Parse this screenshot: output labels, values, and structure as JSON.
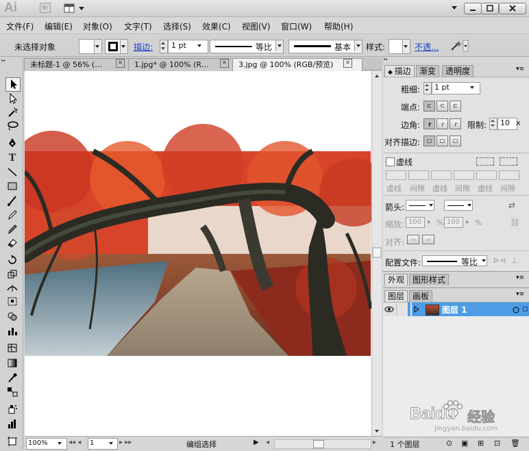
{
  "app": {
    "logo": "Ai",
    "bridge": "Br"
  },
  "menubar": [
    "文件(F)",
    "编辑(E)",
    "对象(O)",
    "文字(T)",
    "选择(S)",
    "效果(C)",
    "视图(V)",
    "窗口(W)",
    "帮助(H)"
  ],
  "control": {
    "selection_status": "未选择对象",
    "stroke_label": "描边:",
    "stroke_weight": "1 pt",
    "profile_label": "等比",
    "brush_label": "基本",
    "style_label": "样式:",
    "opacity_link": "不透..."
  },
  "tabs": [
    {
      "label": "未标题-1 @ 56% (…",
      "active": false
    },
    {
      "label": "1.jpg* @ 100% (R…",
      "active": false
    },
    {
      "label": "3.jpg @ 100% (RGB/预览)",
      "active": true
    }
  ],
  "status": {
    "zoom": "100%",
    "artboard": "1",
    "mode": "编组选择"
  },
  "stroke_panel": {
    "tabs": [
      "描边",
      "渐变",
      "透明度"
    ],
    "weight_label": "粗细:",
    "weight_value": "1 pt",
    "cap_label": "端点:",
    "corner_label": "边角:",
    "limit_label": "限制:",
    "limit_value": "10",
    "limit_unit": "x",
    "align_label": "对齐描边:",
    "dashed_label": "虚线",
    "dash_labels": [
      "虚线",
      "间隙",
      "虚线",
      "间隙",
      "虚线",
      "间隙"
    ],
    "arrow_label": "箭头:",
    "scale_label": "缩放:",
    "scale_value_1": "100",
    "scale_value_2": "100",
    "percent": "%",
    "align2_label": "对齐:",
    "profile_file_label": "配置文件:",
    "profile_value": "等比"
  },
  "appearance_panel": {
    "tabs": [
      "外观",
      "图形样式"
    ]
  },
  "layers_panel": {
    "tabs": [
      "图层",
      "画板"
    ],
    "layer_name": "图层 1",
    "footer": "1 个图层"
  },
  "watermark": {
    "brand": "Baidu",
    "cn": "经验",
    "url": "jingyan.baidu.com"
  },
  "colors": {
    "layer_selected": "#4e9ce6",
    "link_blue": "#1a3cc8",
    "foliage_red": "#d8442a",
    "bark": "#2b2b24"
  }
}
